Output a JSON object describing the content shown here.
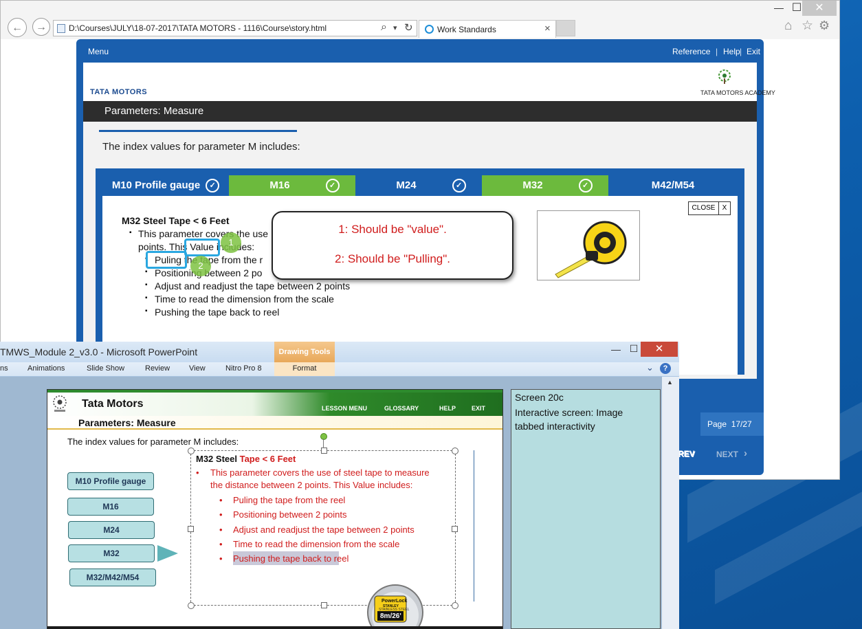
{
  "browser": {
    "address": "D:\\Courses\\JULY\\18-07-2017\\TATA MOTORS - 1116\\Course\\story.html",
    "tab_title": "Work Standards",
    "tab_close": "×",
    "tab_new": "",
    "min_label": "—",
    "max_label": "☐",
    "close_label": "✕",
    "back_glyph": "←",
    "forward_glyph": "→",
    "search_glyph": "⌕",
    "dropdown_glyph": "▾",
    "refresh_glyph": "↻",
    "home_glyph": "⌂",
    "fav_glyph": "☆",
    "settings_glyph": "⚙"
  },
  "player": {
    "menu": "Menu",
    "reference": "Reference",
    "help": "Help",
    "exit": "Exit",
    "sep": "|",
    "brand": "TATA MOTORS",
    "academy": "TATA MOTORS ACADEMY",
    "slide_title": "Parameters: Measure",
    "intro": "The index values for parameter M includes:",
    "tabs": [
      {
        "label": "M10 Profile gauge",
        "check": "✓"
      },
      {
        "label": "M16",
        "check": "✓"
      },
      {
        "label": "M24",
        "check": "✓"
      },
      {
        "label": "M32",
        "check": "✓"
      },
      {
        "label": "M42/M54",
        "check": ""
      }
    ],
    "close_label": "CLOSE",
    "close_x": "X",
    "heading": "M32 Steel Tape < 6 Feet",
    "para_1": "This parameter covers the use",
    "para_2a": "points. This ",
    "para_2b": "Value",
    "para_2c": " includes:",
    "items": [
      {
        "a": "Puling",
        "b": " the tape from the r"
      },
      {
        "a": "",
        "b": "Positioning between 2 po"
      },
      {
        "a": "",
        "b": "Adjust and readjust the tape between 2 points"
      },
      {
        "a": "",
        "b": "Time to read the dimension from the scale"
      },
      {
        "a": "",
        "b": "Pushing the tape back to reel"
      }
    ],
    "callout_1": "1: Should be \"value\".",
    "callout_2": "2: Should be \"Pulling\".",
    "marker_1": "1",
    "marker_2": "2",
    "page": "Page  17/27",
    "prev": "PREV",
    "next": "NEXT",
    "prev_arrow": "‹",
    "next_arrow": "›",
    "bullet": "▪"
  },
  "ppt": {
    "title": "TMWS_Module 2_v3.0  -  Microsoft PowerPoint",
    "drawing_tools": "Drawing Tools",
    "min_label": "—",
    "max_label": "☐",
    "close_label": "✕",
    "ribbon": [
      "ns",
      "Animations",
      "Slide Show",
      "Review",
      "View",
      "Nitro Pro 8"
    ],
    "format": "Format",
    "ribbon_chevron": "⌄",
    "ribbon_help": "?",
    "scroll_up": "▲",
    "slide": {
      "company": "Tata Motors",
      "nav": [
        "LESSON MENU",
        "GLOSSARY",
        "HELP",
        "EXIT"
      ],
      "title": "Parameters: Measure",
      "intro": "The index values for parameter M includes:",
      "buttons": [
        "M10 Profile gauge",
        "M16",
        "M24",
        "M32",
        "M32/M42/M54"
      ],
      "heading_a": "M32 Steel ",
      "heading_b": "Tape < 6 Feet",
      "para": "This parameter covers the use of steel tape to measure",
      "para2": "the distance between 2 points. This Value includes:",
      "items": [
        "Puling the tape from the reel",
        "Positioning between 2 points",
        "Adjust and readjust the tape between 2 points",
        "Time to read the dimension from the scale",
        "Pushing the tape back to reel"
      ],
      "bullet": "•",
      "tape_brand": "PowerLock",
      "tape_maker": "STANLEY",
      "tape_size": "8m/26'",
      "tape_sub": "STAINLESS STEEL"
    },
    "notes": {
      "line1": "Screen 20c",
      "line2": "Interactive screen: Image tabbed interactivity"
    }
  },
  "colors": {
    "player_blue": "#1a5fae",
    "tab_blue": "#1a5fae",
    "tab_green": "#6cba3d",
    "highlight": "#2aa7e0",
    "marker_green": "#7ec243",
    "red": "#d01c1c"
  }
}
